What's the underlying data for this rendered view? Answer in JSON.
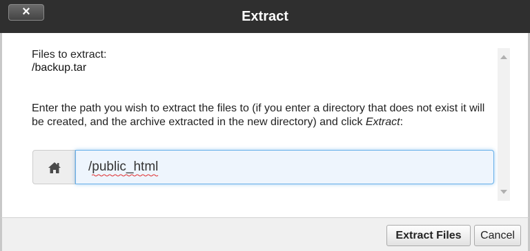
{
  "dialog": {
    "title": "Extract",
    "close_label": "×"
  },
  "body": {
    "files_label": "Files to extract:",
    "file_path": "/backup.tar",
    "instructions_prefix": "Enter the path you wish to extract the files to (if you enter a directory that does not exist it will be created, and the archive extracted in the new directory) and click ",
    "instructions_action": "Extract",
    "instructions_suffix": ":"
  },
  "path_input": {
    "value": "/public_html",
    "icon": "home-icon"
  },
  "footer": {
    "extract_label": "Extract Files",
    "cancel_label": "Cancel"
  },
  "colors": {
    "titlebar": "#2f2f2f",
    "input_focus": "#66afe9",
    "footer_bg": "#f0f0f0"
  }
}
